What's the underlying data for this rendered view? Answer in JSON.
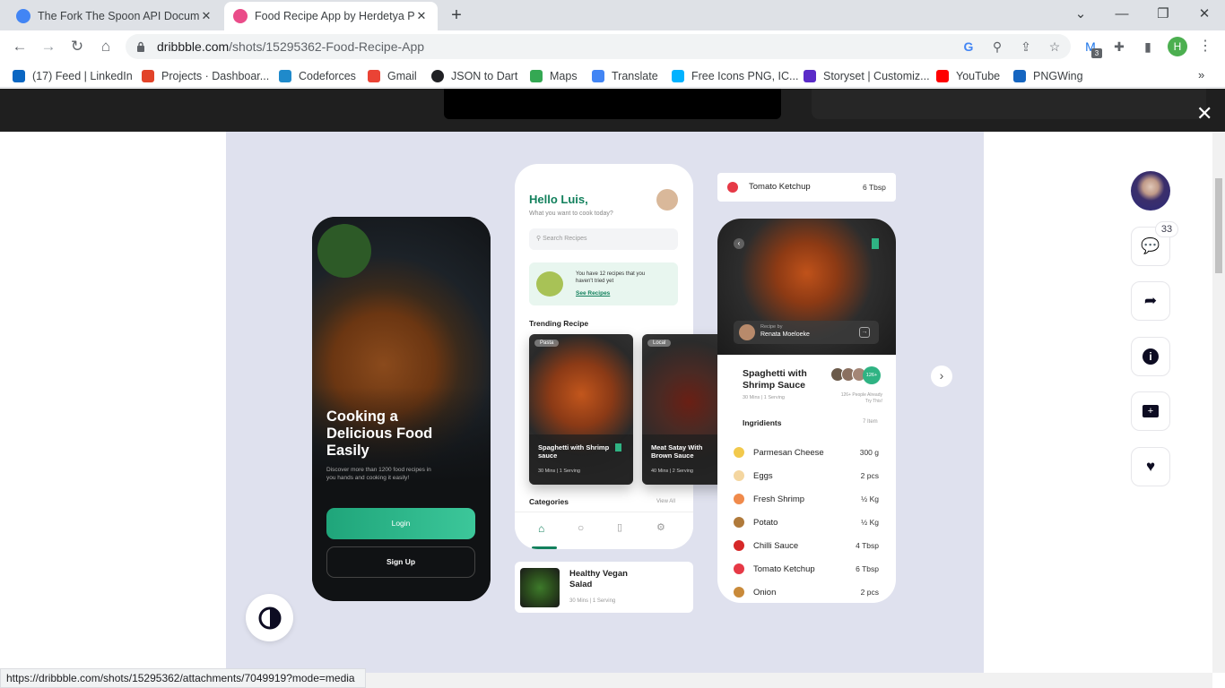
{
  "browser": {
    "tabs": [
      {
        "title": "The Fork The Spoon API Docume",
        "active": false,
        "favicon_color": "#4285f4"
      },
      {
        "title": "Food Recipe App by Herdetya Pr",
        "active": true,
        "favicon_color": "#ea4c89"
      }
    ],
    "new_tab_symbol": "+",
    "url_host": "dribbble.com",
    "url_path": "/shots/15295362-Food-Recipe-App",
    "bookmarks": [
      {
        "label": "(17) Feed | LinkedIn",
        "color": "#0a66c2"
      },
      {
        "label": "Projects · Dashboar...",
        "color": "#e24329"
      },
      {
        "label": "Codeforces",
        "color": "#1f8acb"
      },
      {
        "label": "Gmail",
        "color": "#ea4335"
      },
      {
        "label": "JSON to Dart",
        "color": "#202124"
      },
      {
        "label": "Maps",
        "color": "#34a853"
      },
      {
        "label": "Translate",
        "color": "#4285f4"
      },
      {
        "label": "Free Icons PNG, IC...",
        "color": "#00b2ff"
      },
      {
        "label": "Storyset | Customiz...",
        "color": "#5a2bc8"
      },
      {
        "label": "YouTube",
        "color": "#ff0000"
      },
      {
        "label": "PNGWing",
        "color": "#1565c0"
      }
    ],
    "extension_badge": "3",
    "profile_initial": "H",
    "status_url": "https://dribbble.com/shots/15295362/attachments/7049919?mode=media"
  },
  "shot": {
    "onboarding": {
      "headline": "Cooking a Delicious Food Easily",
      "subtext": "Discover more than 1200 food recipes in you hands and cooking it easily!",
      "login_label": "Login",
      "signup_label": "Sign Up"
    },
    "home": {
      "greeting": "Hello Luis,",
      "prompt": "What you want to cook today?",
      "search_placeholder": "Search Recipes",
      "banner_text": "You have 12 recipes that you haven't tried yet",
      "banner_link": "See Recipes",
      "trending_title": "Trending Recipe",
      "trending": [
        {
          "tag": "Pasta",
          "name": "Spaghetti with Shrimp sauce",
          "meta": "30 Mins | 1 Serving"
        },
        {
          "tag": "Local",
          "name": "Meat Satay With Brown Sauce",
          "meta": "40 Mins | 2 Serving"
        }
      ],
      "categories_title": "Categories",
      "view_all": "View All"
    },
    "salad": {
      "name": "Healthy Vegan Salad",
      "meta": "30 Mins | 1 Serving"
    },
    "detail": {
      "top_item": {
        "name": "Tomato Ketchup",
        "qty": "6 Tbsp"
      },
      "recipe_by_label": "Recipe by",
      "author": "Renata Moeloeke",
      "title": "Spaghetti with Shrimp Sauce",
      "meta": "30 Mins | 1 Serving",
      "people_count": "126+",
      "people_text": "126+ People Already Try This!",
      "ingredients_title": "Ingridients",
      "ingredients_count": "7 Item",
      "ingredients": [
        {
          "name": "Parmesan Cheese",
          "qty": "300 g",
          "color": "#f2c94c"
        },
        {
          "name": "Eggs",
          "qty": "2 pcs",
          "color": "#f4d6a0"
        },
        {
          "name": "Fresh Shrimp",
          "qty": "½ Kg",
          "color": "#f08a4b"
        },
        {
          "name": "Potato",
          "qty": "½ Kg",
          "color": "#b07a3b"
        },
        {
          "name": "Chilli Sauce",
          "qty": "4 Tbsp",
          "color": "#d62828"
        },
        {
          "name": "Tomato Ketchup",
          "qty": "6 Tbsp",
          "color": "#e63946"
        },
        {
          "name": "Onion",
          "qty": "2 pcs",
          "color": "#c98a3a"
        }
      ]
    }
  },
  "sidebar": {
    "comment_count": "33"
  }
}
